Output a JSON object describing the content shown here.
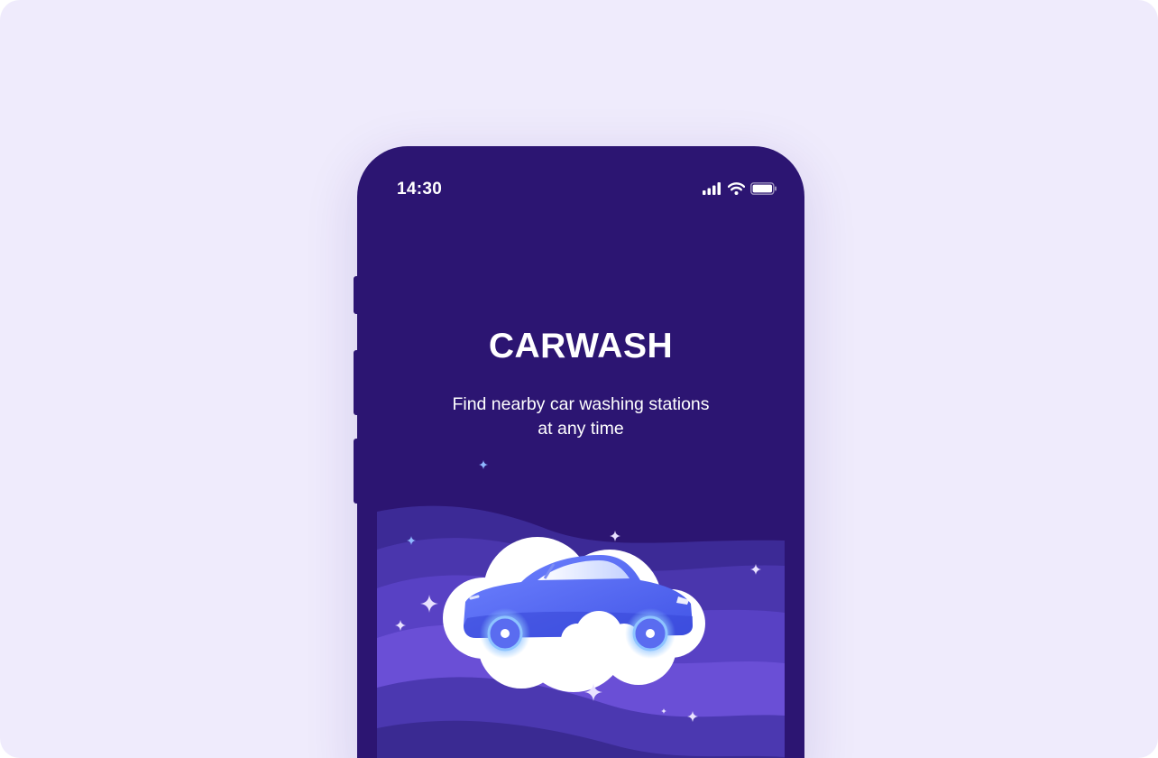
{
  "status_bar": {
    "time": "14:30",
    "icons": [
      "signal-icon",
      "wifi-icon",
      "battery-icon"
    ]
  },
  "splash": {
    "title": "CARWASH",
    "subtitle_line1": "Find nearby car washing stations",
    "subtitle_line2": "at any time"
  },
  "colors": {
    "page_background": "#efebfc",
    "phone_background": "#2c1572",
    "wave_light": "#6a4fd6",
    "wave_dark": "#43309e",
    "car_body": "#5b6df0",
    "wheel_glow": "#7fb6ff",
    "cloud": "#ffffff"
  },
  "illustration": {
    "subject": "car-in-foam-cloud",
    "decorations": [
      "sparkle-icon",
      "wave-layers"
    ]
  }
}
